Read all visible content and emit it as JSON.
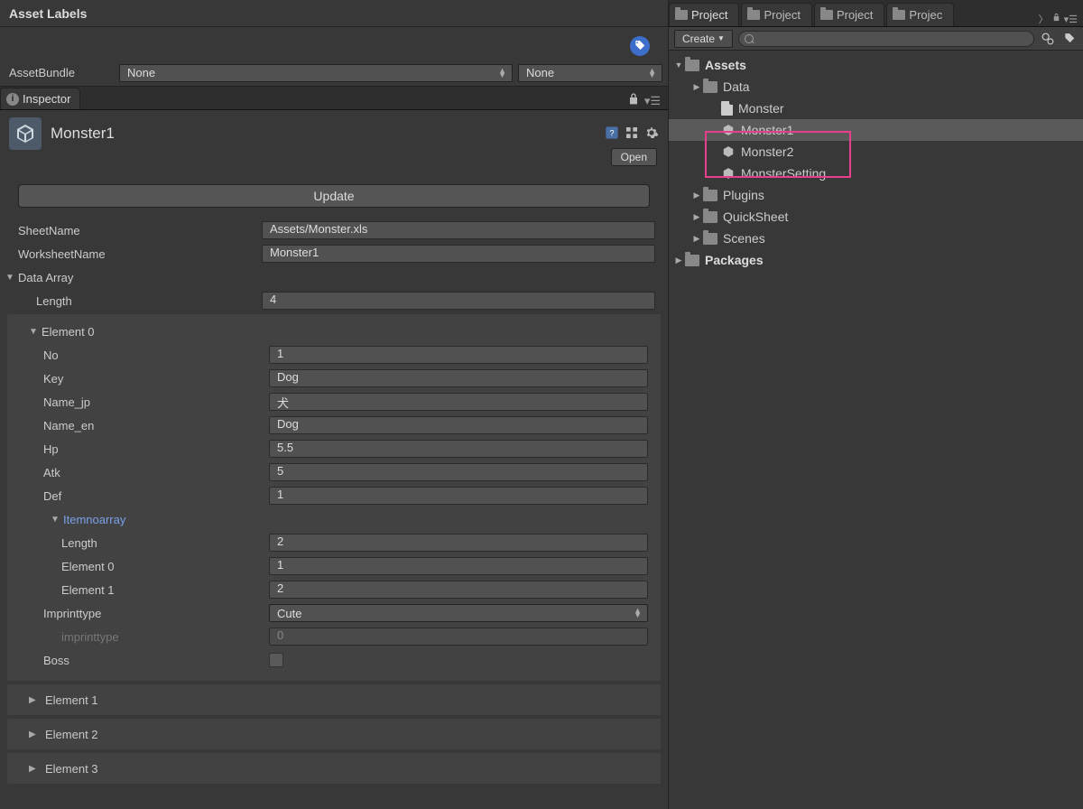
{
  "header": {
    "asset_labels": "Asset Labels"
  },
  "assetbundle": {
    "label": "AssetBundle",
    "value1": "None",
    "value2": "None"
  },
  "inspector": {
    "tab": "Inspector",
    "object_name": "Monster1",
    "open_btn": "Open",
    "update_btn": "Update",
    "sheet_name_label": "SheetName",
    "sheet_name_value": "Assets/Monster.xls",
    "worksheet_name_label": "WorksheetName",
    "worksheet_name_value": "Monster1",
    "data_array_label": "Data Array",
    "length_label": "Length",
    "length_value": "4",
    "element0": {
      "title": "Element 0",
      "no_label": "No",
      "no_value": "1",
      "key_label": "Key",
      "key_value": "Dog",
      "name_jp_label": "Name_jp",
      "name_jp_value": "犬",
      "name_en_label": "Name_en",
      "name_en_value": "Dog",
      "hp_label": "Hp",
      "hp_value": "5.5",
      "atk_label": "Atk",
      "atk_value": "5",
      "def_label": "Def",
      "def_value": "1",
      "itemnoarray_label": "Itemnoarray",
      "itemnoarray_length_label": "Length",
      "itemnoarray_length_value": "2",
      "item_el0_label": "Element 0",
      "item_el0_value": "1",
      "item_el1_label": "Element 1",
      "item_el1_value": "2",
      "imprinttype_label": "Imprinttype",
      "imprinttype_value": "Cute",
      "imprinttype_sub_label": "imprinttype",
      "imprinttype_sub_value": "0",
      "boss_label": "Boss"
    },
    "elements": {
      "e1": "Element 1",
      "e2": "Element 2",
      "e3": "Element 3"
    }
  },
  "project": {
    "tab": "Project",
    "create_btn": "Create",
    "tree": {
      "assets": "Assets",
      "data": "Data",
      "monster": "Monster",
      "monster1": "Monster1",
      "monster2": "Monster2",
      "monster_setting": "MonsterSetting",
      "plugins": "Plugins",
      "quicksheet": "QuickSheet",
      "scenes": "Scenes",
      "packages": "Packages"
    }
  }
}
